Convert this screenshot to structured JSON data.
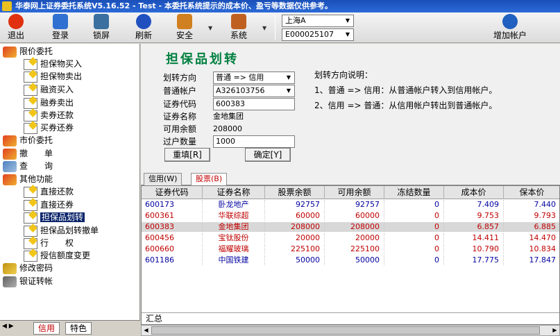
{
  "window": {
    "title": "华泰网上证券委托系统V5.16.52 - Test - 本委托系统提示的成本价、盈亏等数据仅供参考。"
  },
  "toolbar": {
    "buttons": [
      {
        "label": "退出",
        "icon": "exit-icon",
        "color": "#e03010"
      },
      {
        "label": "登录",
        "icon": "users-icon",
        "color": "#3070d0"
      },
      {
        "label": "锁屏",
        "icon": "screen-lock-icon",
        "color": "#3a6fa0"
      },
      {
        "label": "刷新",
        "icon": "refresh-icon",
        "color": "#2050c0"
      },
      {
        "label": "安全",
        "icon": "security-icon",
        "color": "#d08020"
      },
      {
        "label": "系统",
        "icon": "system-tools-icon",
        "color": "#c06020"
      }
    ],
    "market_select": "上海A",
    "account_select": "E000025107",
    "add_account_label": "增加帐户"
  },
  "tree": {
    "items": [
      {
        "label": "限价委托",
        "type": "group"
      },
      {
        "label": "担保物买入",
        "type": "page"
      },
      {
        "label": "担保物卖出",
        "type": "page"
      },
      {
        "label": "融资买入",
        "type": "page"
      },
      {
        "label": "融券卖出",
        "type": "page"
      },
      {
        "label": "卖券还款",
        "type": "page"
      },
      {
        "label": "买券还券",
        "type": "page"
      },
      {
        "label": "市价委托",
        "type": "group"
      },
      {
        "label": "撤　　单",
        "type": "group"
      },
      {
        "label": "查　　询",
        "type": "group"
      },
      {
        "label": "其他功能",
        "type": "group"
      },
      {
        "label": "直接还款",
        "type": "page"
      },
      {
        "label": "直接还券",
        "type": "page"
      },
      {
        "label": "担保品划转",
        "type": "page",
        "selected": true
      },
      {
        "label": "担保品划转撤单",
        "type": "page"
      },
      {
        "label": "行　　权",
        "type": "page"
      },
      {
        "label": "授信额度变更",
        "type": "page"
      },
      {
        "label": "修改密码",
        "type": "group"
      },
      {
        "label": "银证转帐",
        "type": "group"
      }
    ],
    "bottom_tabs": [
      "信用",
      "特色"
    ]
  },
  "form": {
    "title": "担保品划转",
    "direction_label": "划转方向",
    "direction_value": "普通 => 信用",
    "account_label": "普通帐户",
    "account_value": "A326103756",
    "code_label": "证券代码",
    "code_value": "600383",
    "name_label": "证券名称",
    "name_value": "金地集团",
    "balance_label": "可用余额",
    "balance_value": "208000",
    "qty_label": "过户数量",
    "qty_value": "1000",
    "reset_label": "重填[R]",
    "confirm_label": "确定[Y]"
  },
  "help": {
    "title": "划转方向说明：",
    "line1": "1、普通 => 信用：从普通帐户转入到信用帐户。",
    "line2": "2、信用 => 普通：从信用帐户转出到普通帐户。"
  },
  "data_tabs": [
    "信用(W)",
    "股票(B)"
  ],
  "table": {
    "columns": [
      "证券代码",
      "证券名称",
      "股票余额",
      "可用余额",
      "冻结数量",
      "成本价",
      "保本价"
    ],
    "rows": [
      {
        "code": "600173",
        "name": "卧龙地产",
        "stock_balance": "92757",
        "available": "92757",
        "frozen": "0",
        "cost": "7.409",
        "breakeven": "7.440",
        "color": "#0000a0"
      },
      {
        "code": "600361",
        "name": "华联综超",
        "stock_balance": "60000",
        "available": "60000",
        "frozen": "0",
        "cost": "9.753",
        "breakeven": "9.793",
        "color": "#c00000"
      },
      {
        "code": "600383",
        "name": "金地集团",
        "stock_balance": "208000",
        "available": "208000",
        "frozen": "0",
        "cost": "6.857",
        "breakeven": "6.885",
        "color": "#c00000"
      },
      {
        "code": "600456",
        "name": "宝钛股份",
        "stock_balance": "20000",
        "available": "20000",
        "frozen": "0",
        "cost": "14.411",
        "breakeven": "14.470",
        "color": "#c00000"
      },
      {
        "code": "600660",
        "name": "福耀玻璃",
        "stock_balance": "225100",
        "available": "225100",
        "frozen": "0",
        "cost": "10.790",
        "breakeven": "10.834",
        "color": "#c00000"
      },
      {
        "code": "601186",
        "name": "中国铁建",
        "stock_balance": "50000",
        "available": "50000",
        "frozen": "0",
        "cost": "17.775",
        "breakeven": "17.847",
        "color": "#0000a0"
      }
    ],
    "summary_label": "汇总"
  }
}
